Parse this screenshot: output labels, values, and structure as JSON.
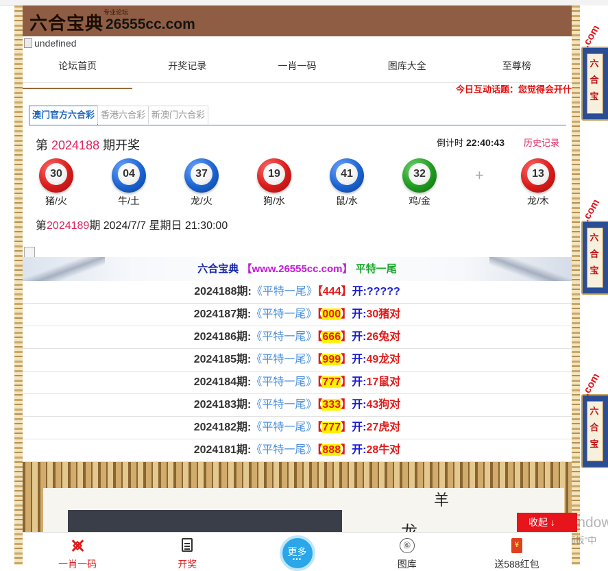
{
  "header": {
    "logo_text": "六合宝典",
    "logo_domain": "26555cc.com",
    "logo_tag": "专业论坛",
    "broken_image_alt": "undefined"
  },
  "nav": {
    "items": [
      {
        "label": "论坛首页"
      },
      {
        "label": "开奖记录"
      },
      {
        "label": "一肖一码"
      },
      {
        "label": "图库大全"
      },
      {
        "label": "至尊榜"
      }
    ],
    "active_index": 0
  },
  "marquee": "今日互动话题：您觉得会开什",
  "lottery_tabs": [
    {
      "label": "澳门官方六合彩"
    },
    {
      "label": "香港六合彩"
    },
    {
      "label": "新澳门六合彩"
    }
  ],
  "draw": {
    "prefix": "第",
    "number": "2024188",
    "suffix": "期开奖",
    "countdown_label": "倒计时",
    "countdown_value": "22:40:43",
    "history_label": "历史记录",
    "plus": "+",
    "balls": [
      {
        "number": "30",
        "label": "猪/火",
        "color": "red"
      },
      {
        "number": "04",
        "label": "牛/土",
        "color": "blue"
      },
      {
        "number": "37",
        "label": "龙/火",
        "color": "blue"
      },
      {
        "number": "19",
        "label": "狗/水",
        "color": "red"
      },
      {
        "number": "41",
        "label": "鼠/水",
        "color": "blue"
      },
      {
        "number": "32",
        "label": "鸡/金",
        "color": "green"
      },
      {
        "number": "13",
        "label": "龙/木",
        "color": "red"
      }
    ]
  },
  "next_draw": {
    "prefix": "第",
    "number": "2024189",
    "suffix": "期 2024/7/7 星期日 21:30:00"
  },
  "banner": {
    "part1": "六合宝典",
    "part2": "【www.26555cc.com】",
    "part3": "平特一尾"
  },
  "records": [
    {
      "issue": "2024188期:",
      "tag": "《平特一尾》",
      "code": "444",
      "open": "开:",
      "result": "?????",
      "highlight": false
    },
    {
      "issue": "2024187期:",
      "tag": "《平特一尾》",
      "code": "000",
      "open": "开:",
      "result": "30猪对",
      "highlight": true
    },
    {
      "issue": "2024186期:",
      "tag": "《平特一尾》",
      "code": "666",
      "open": "开:",
      "result": "26兔对",
      "highlight": true
    },
    {
      "issue": "2024185期:",
      "tag": "《平特一尾》",
      "code": "999",
      "open": "开:",
      "result": "49龙对",
      "highlight": true
    },
    {
      "issue": "2024184期:",
      "tag": "《平特一尾》",
      "code": "777",
      "open": "开:",
      "result": "17鼠对",
      "highlight": true
    },
    {
      "issue": "2024183期:",
      "tag": "《平特一尾》",
      "code": "333",
      "open": "开:",
      "result": "43狗对",
      "highlight": true
    },
    {
      "issue": "2024182期:",
      "tag": "《平特一尾》",
      "code": "777",
      "open": "开:",
      "result": "27虎对",
      "highlight": true
    },
    {
      "issue": "2024181期:",
      "tag": "《平特一尾》",
      "code": "888",
      "open": "开:",
      "result": "28牛对",
      "highlight": true
    }
  ],
  "picture": {
    "callig_1": "羊",
    "callig_2": "龙"
  },
  "bottom_nav": [
    {
      "label": "一肖一码",
      "icon": "target-icon"
    },
    {
      "label": "开奖",
      "icon": "document-icon"
    },
    {
      "label": "更多",
      "icon": "more-icon",
      "dots": "•••"
    },
    {
      "label": "图库",
      "icon": "circle-six-icon",
      "glyph": "⑥"
    },
    {
      "label": "送588红包",
      "icon": "red-packet-icon"
    }
  ],
  "collapse_label": "收起 ↓",
  "side_ads": {
    "glyphs": [
      "六",
      "合",
      "宝"
    ],
    "domain_fragment": ".com"
  },
  "os_watermark": {
    "line1": "激活 Windows",
    "line2": "转到\"控制面板\"中"
  }
}
